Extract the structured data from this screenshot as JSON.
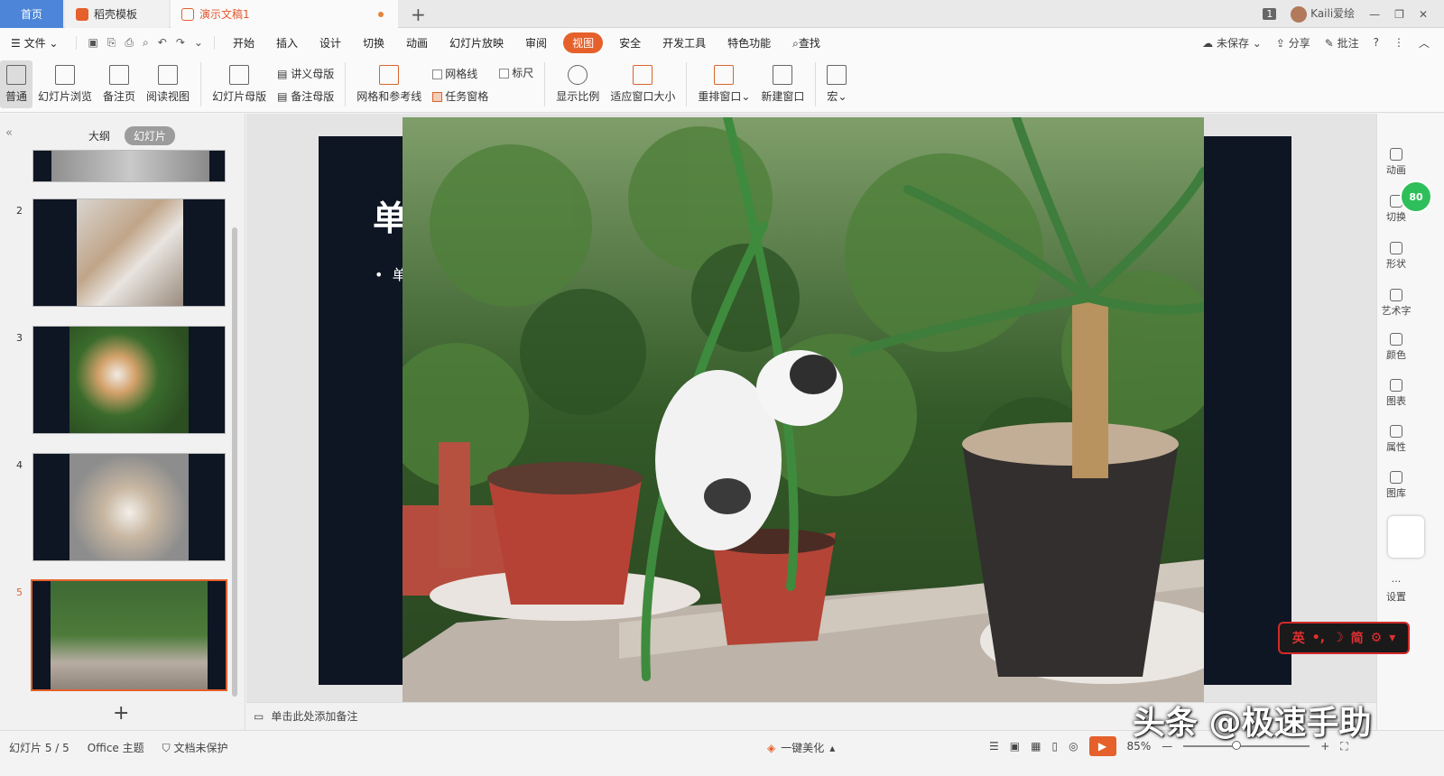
{
  "tabs": {
    "home": "首页",
    "daoke": "稻壳模板",
    "doc": "演示文稿1"
  },
  "titlebar": {
    "count": "1",
    "user": "Kaili爱绘"
  },
  "menu": {
    "file": "文件",
    "items": [
      "开始",
      "插入",
      "设计",
      "切换",
      "动画",
      "幻灯片放映",
      "审阅",
      "视图",
      "安全",
      "开发工具",
      "特色功能"
    ],
    "search": "查找",
    "unsaved": "未保存",
    "share": "分享",
    "comment": "批注"
  },
  "ribbon": {
    "normal": "普通",
    "sorter": "幻灯片浏览",
    "notes_page": "备注页",
    "reading": "阅读视图",
    "master": "幻灯片母版",
    "handout_master": "讲义母版",
    "notes_master": "备注母版",
    "grid_guides": "网格和参考线",
    "gridlines": "网格线",
    "ruler": "标尺",
    "task_pane": "任务窗格",
    "zoom": "显示比例",
    "fit_window": "适应窗口大小",
    "arrange": "重排窗口",
    "new_window": "新建窗口",
    "macro": "宏"
  },
  "leftpanel": {
    "outline_tab": "大纲",
    "slides_tab": "幻灯片",
    "slide_numbers": [
      "2",
      "3",
      "4",
      "5"
    ]
  },
  "slide": {
    "title_fragment": "单",
    "bullet_fragment": "单"
  },
  "notes_placeholder": "单击此处添加备注",
  "rightpanel": {
    "items": [
      "动画",
      "切换",
      "形状",
      "艺术字",
      "颜色",
      "图表",
      "属性",
      "图库",
      "设置"
    ],
    "badge": "80"
  },
  "ime": {
    "lang": "英",
    "mode": "简"
  },
  "status": {
    "slide_pos": "幻灯片 5 / 5",
    "theme": "Office 主题",
    "protect": "文档未保护",
    "beautify": "一键美化",
    "zoom": "85%"
  },
  "watermark": "头条 @极速手助",
  "colors": {
    "accent": "#e5602b",
    "home_tab": "#4d86d8",
    "slide_bg": "#0e1523"
  }
}
